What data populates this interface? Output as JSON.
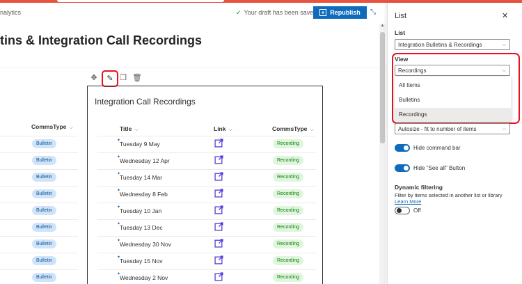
{
  "header": {
    "analytics_label": "nalytics",
    "saved_message": "Your draft has been saved",
    "republish_label": "Republish"
  },
  "page": {
    "title": "tins & Integration Call Recordings"
  },
  "webpart": {
    "title": "Integration Call Recordings",
    "columns": {
      "title": "Title",
      "link": "Link",
      "commstype": "CommsType"
    },
    "rows": [
      {
        "title": "Tuesday 9 May",
        "type": "Recording"
      },
      {
        "title": "Wednesday 12 Apr",
        "type": "Recording"
      },
      {
        "title": "Tuesday 14 Mar",
        "type": "Recording"
      },
      {
        "title": "Wednesday 8 Feb",
        "type": "Recording"
      },
      {
        "title": "Tuesday 10 Jan",
        "type": "Recording"
      },
      {
        "title": "Tuesday 13 Dec",
        "type": "Recording"
      },
      {
        "title": "Wednesday 30 Nov",
        "type": "Recording"
      },
      {
        "title": "Tuesday 15 Nov",
        "type": "Recording"
      },
      {
        "title": "Wednesday 2 Nov",
        "type": "Recording"
      }
    ]
  },
  "background_list": {
    "column_commstype": "CommsType",
    "rows": [
      "Bulletin",
      "Bulletin",
      "Bulletin",
      "Bulletin",
      "Bulletin",
      "Bulletin",
      "Bulletin",
      "Bulletin",
      "Bulletin"
    ]
  },
  "panel": {
    "title": "List",
    "list_label": "List",
    "list_value": "Integration Bulletins & Recordings",
    "view_label": "View",
    "view_value": "Recordings",
    "view_options": [
      "All Items",
      "Bulletins",
      "Recordings"
    ],
    "size_value": "Autosize - fit to number of items",
    "hide_command_bar": "Hide command bar",
    "hide_see_all": "Hide \"See all\" Button",
    "dynamic_filtering_label": "Dynamic filtering",
    "dynamic_filtering_desc": "Filter by items selected in another list or library",
    "learn_more": "Learn More",
    "off_label": "Off"
  },
  "colors": {
    "accent": "#0f6cbd",
    "highlight": "#e81123",
    "recording_bg": "#dff6dd",
    "bulletin_bg": "#cfe4fa",
    "topbar": "#e8533f"
  },
  "icons": [
    "move-icon",
    "edit-icon",
    "duplicate-icon",
    "delete-icon",
    "link-icon",
    "close-icon",
    "chevron-down-icon",
    "checkmark-icon",
    "republish-icon",
    "collapse-icon"
  ]
}
